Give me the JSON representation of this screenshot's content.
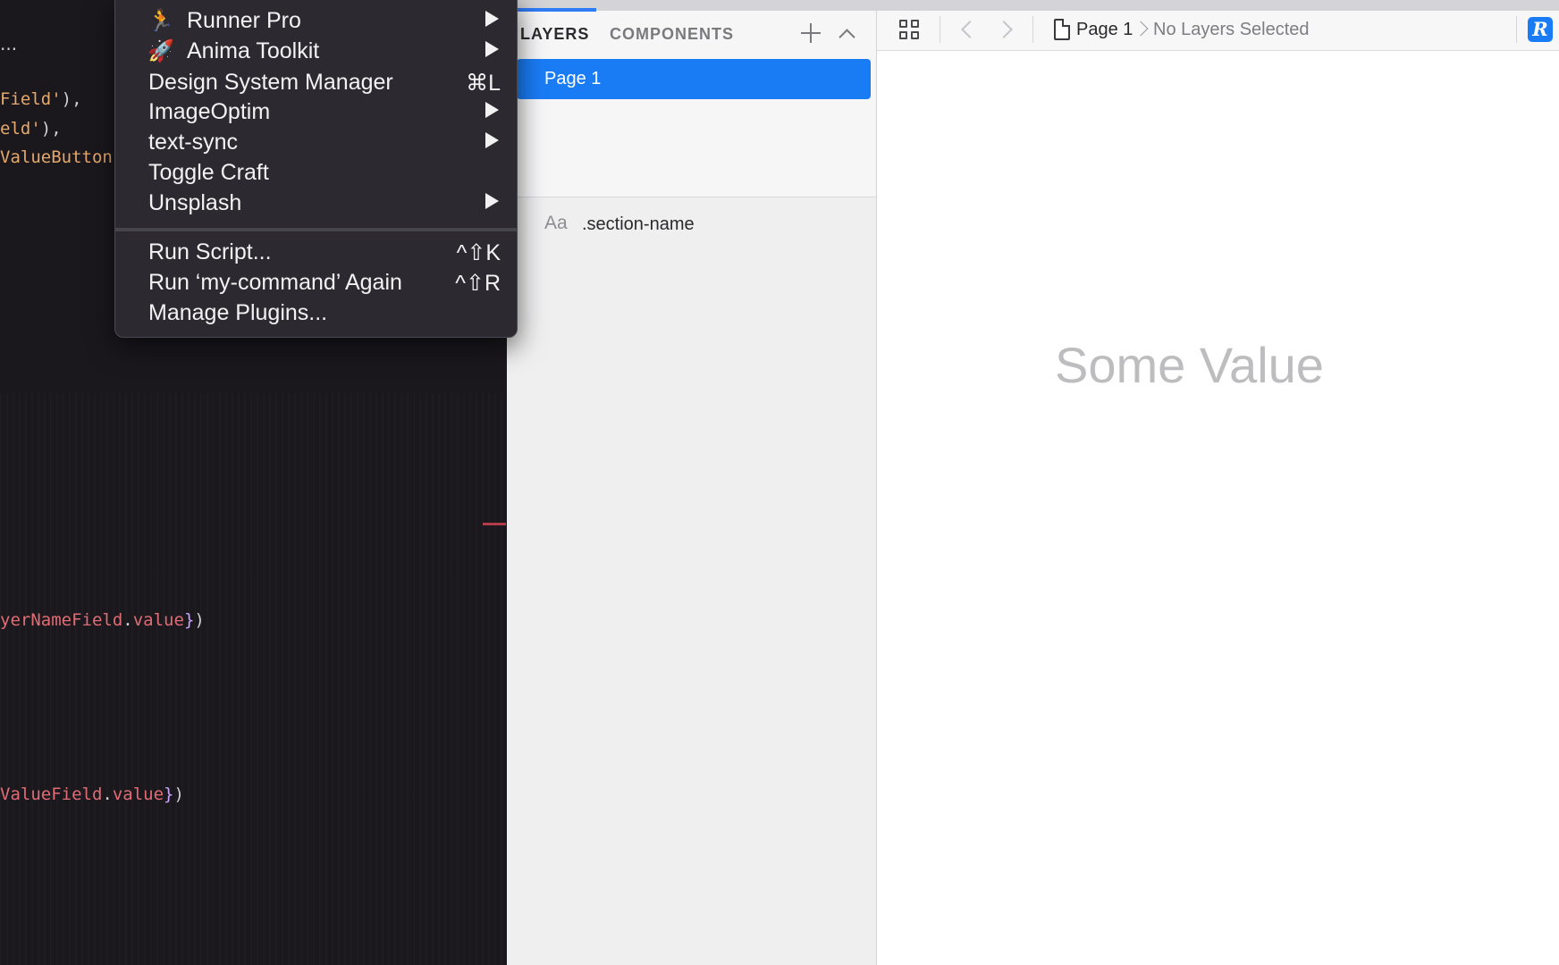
{
  "editor": {
    "ellipsis": "...",
    "lines": [
      {
        "parts": [
          {
            "t": "Field'",
            "c": "str"
          },
          {
            "t": "),",
            "c": "pu"
          }
        ]
      },
      {
        "parts": [
          {
            "t": "eld'",
            "c": "str"
          },
          {
            "t": "),",
            "c": "pu"
          }
        ]
      },
      {
        "parts": [
          {
            "t": "ValueButton",
            "c": "str"
          }
        ]
      },
      {
        "parts": [
          {
            "t": "yerNameField",
            "c": "id"
          },
          {
            "t": ".",
            "c": "pu"
          },
          {
            "t": "value",
            "c": "id"
          },
          {
            "t": "}",
            "c": "br"
          },
          {
            "t": ")",
            "c": "pu"
          }
        ]
      },
      {
        "parts": [
          {
            "t": "ValueField",
            "c": "id"
          },
          {
            "t": ".",
            "c": "pu"
          },
          {
            "t": "value",
            "c": "id"
          },
          {
            "t": "}",
            "c": "br"
          },
          {
            "t": ")",
            "c": "pu"
          }
        ]
      }
    ]
  },
  "menu": {
    "items": [
      {
        "label": "Runner Pro",
        "icon": "runner-icon",
        "glyph": "🏃",
        "submenu": true
      },
      {
        "label": "Anima Toolkit",
        "icon": "rocket-icon",
        "glyph": "🚀",
        "submenu": true
      },
      {
        "label": "Design System Manager",
        "shortcut": "⌘L"
      },
      {
        "label": "ImageOptim",
        "submenu": true
      },
      {
        "label": "text-sync",
        "submenu": true
      },
      {
        "label": "Toggle Craft"
      },
      {
        "label": "Unsplash",
        "submenu": true
      },
      {
        "label": "Run Script...",
        "shortcut": "^⇧K"
      },
      {
        "label": "Run ‘my-command’ Again",
        "shortcut": "^⇧R"
      },
      {
        "label": "Manage Plugins..."
      }
    ]
  },
  "panel": {
    "tabs": [
      "LAYERS",
      "COMPONENTS"
    ],
    "active_tab": "LAYERS",
    "pages": [
      {
        "label": "Page 1",
        "selected": true
      }
    ],
    "layers": [
      {
        "type_icon": "Aa",
        "label": ".section-name"
      }
    ]
  },
  "toolbar": {
    "breadcrumb_page": "Page 1",
    "breadcrumb_selection": "No Layers Selected",
    "plugin_badge": "R"
  },
  "canvas": {
    "text": "Some Value"
  },
  "colors": {
    "accent": "#1a7cf5",
    "menu_bg": "#2c2a30",
    "editor_bg": "#1a181d"
  }
}
